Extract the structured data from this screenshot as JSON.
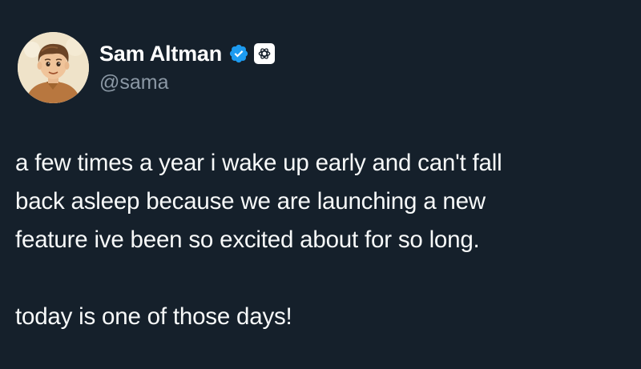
{
  "tweet": {
    "author": {
      "display_name": "Sam Altman",
      "handle": "@sama",
      "avatar_icon": "cartoon-avatar",
      "verified_icon": "verified-badge-icon",
      "affiliate_icon": "openai-logo-icon"
    },
    "text": {
      "lines_paragraph_1": [
        "a few times a year i wake up early and can't fall",
        "back asleep because we are launching a new",
        "feature ive been so excited about for so long."
      ],
      "paragraph_2": "today is one of those days!"
    }
  },
  "colors": {
    "background": "#15202b",
    "text": "#f7f9f9",
    "secondary_text": "#8b98a5",
    "verified_blue": "#1d9bf0"
  }
}
